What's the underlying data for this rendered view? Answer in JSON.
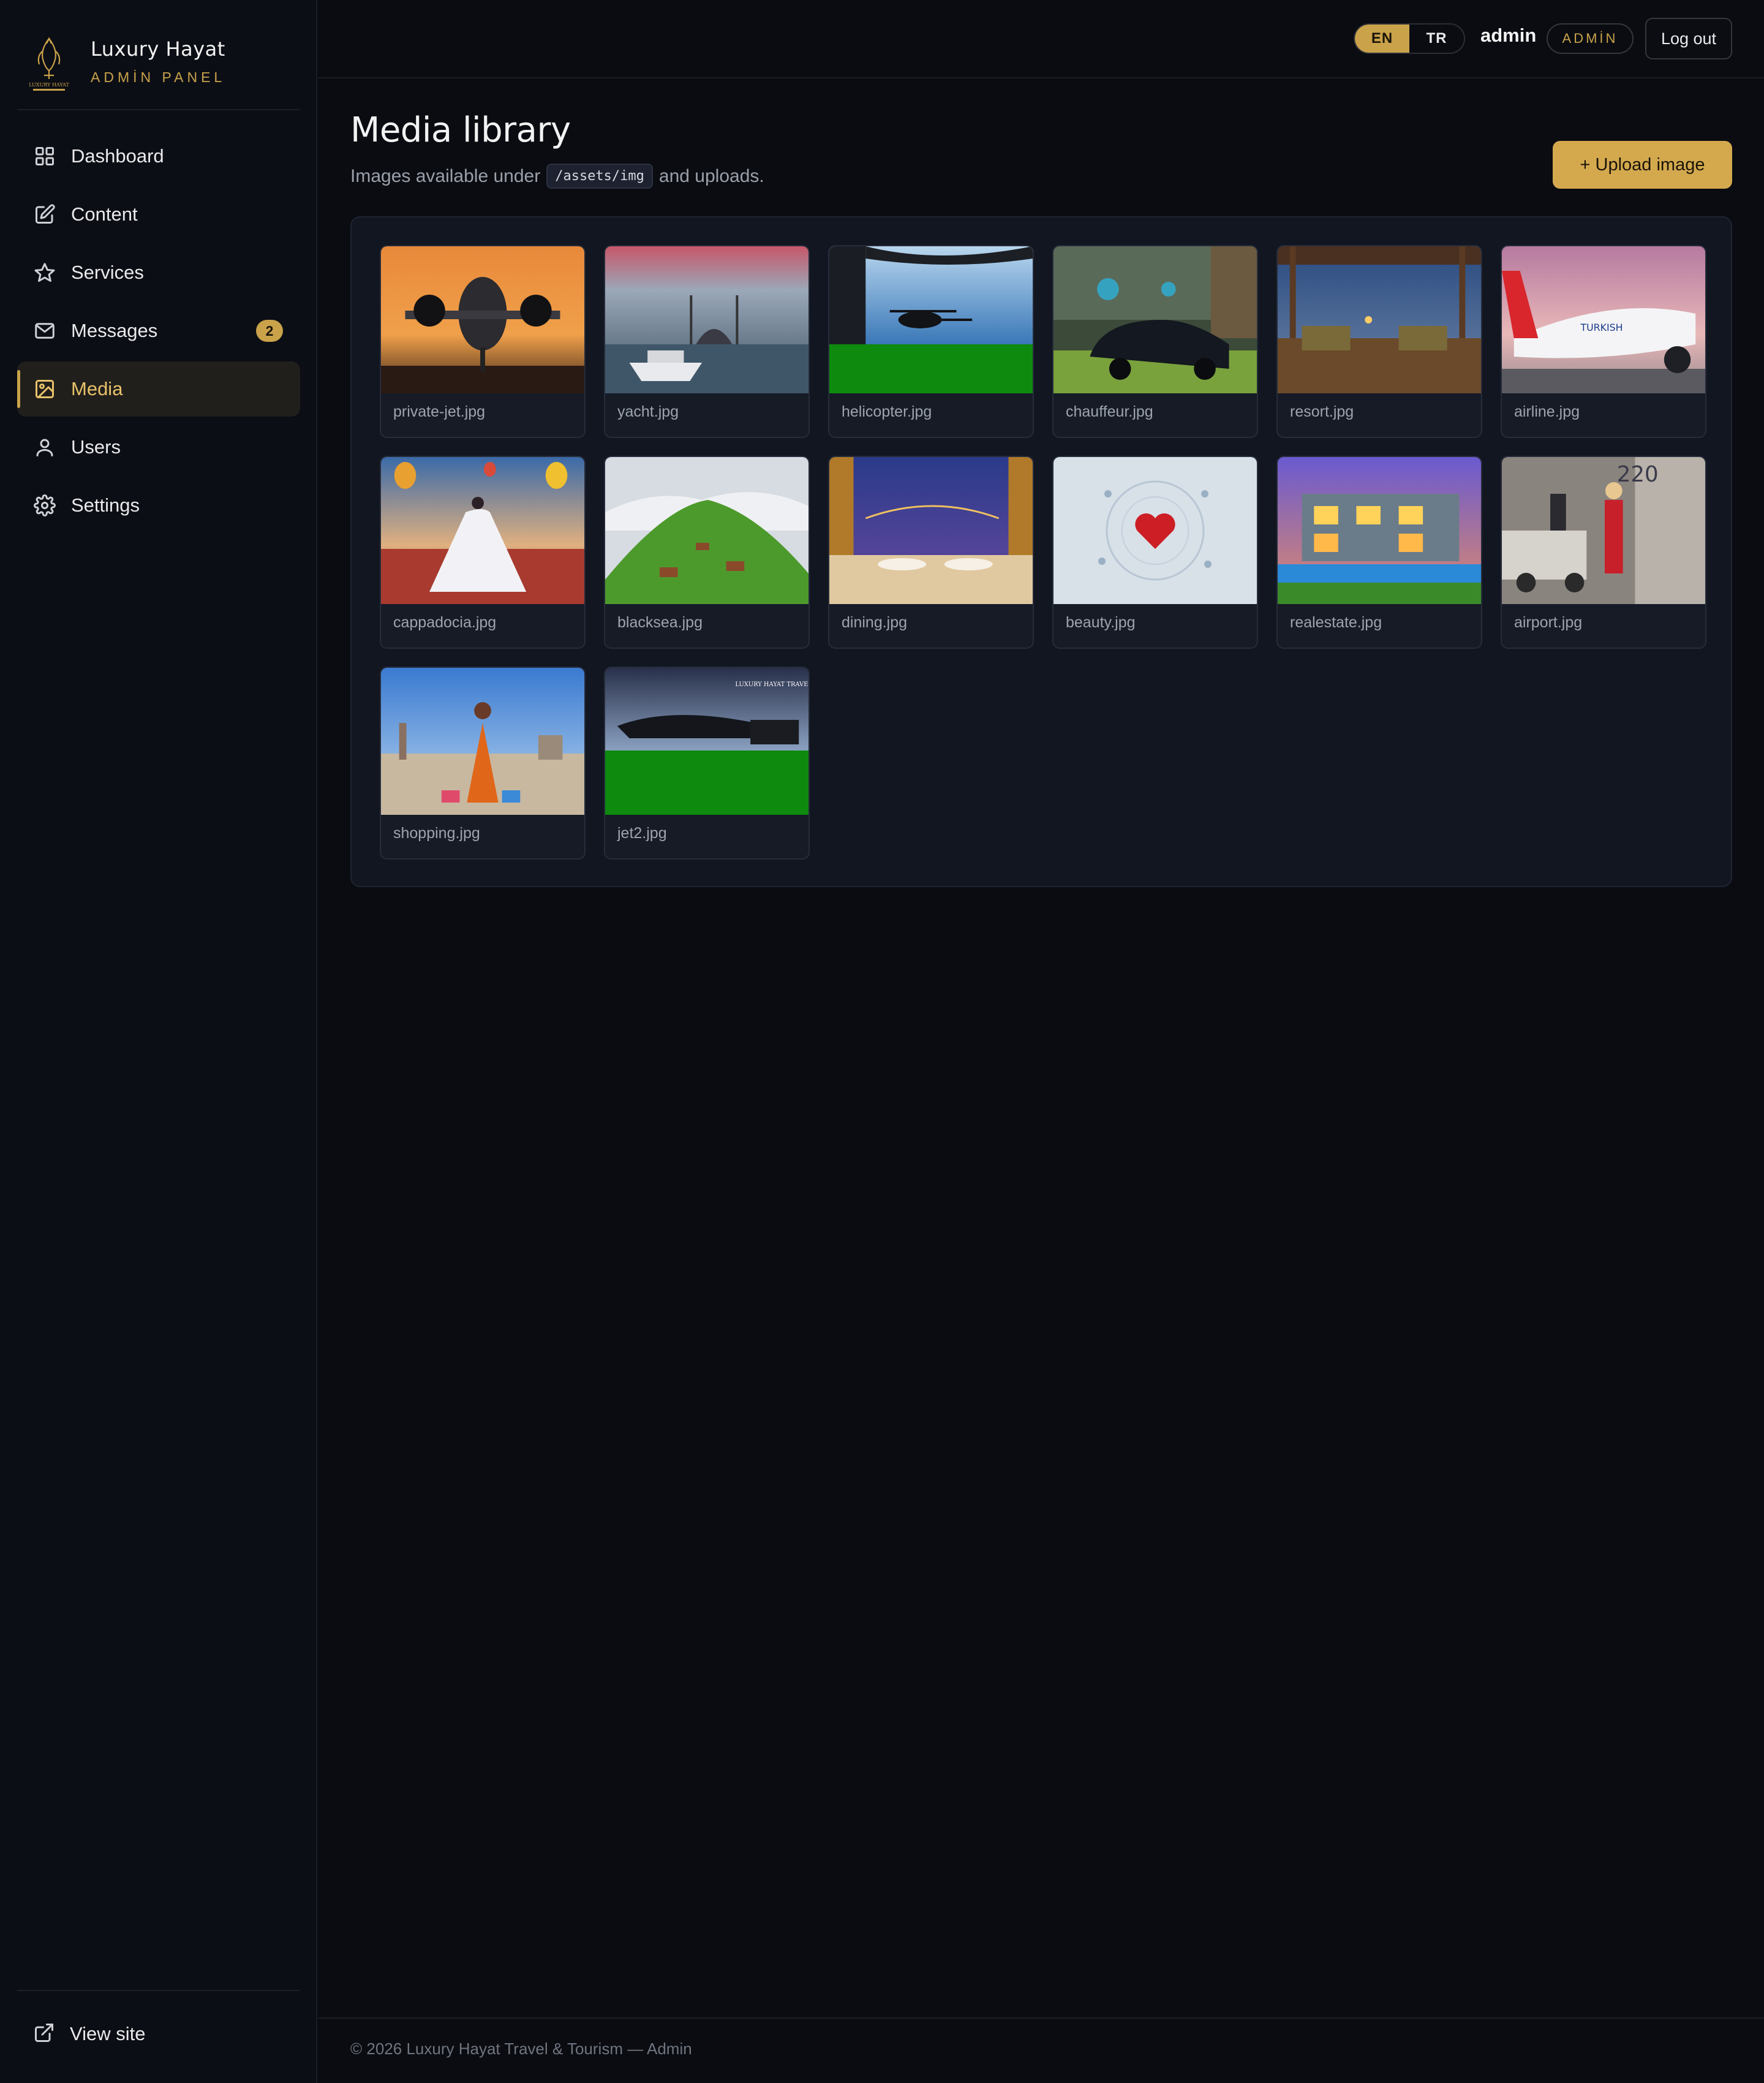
{
  "brand": {
    "title": "Luxury Hayat",
    "subtitle": "ADMİN PANEL"
  },
  "nav": [
    {
      "label": "Dashboard",
      "icon": "grid-icon"
    },
    {
      "label": "Content",
      "icon": "edit-icon"
    },
    {
      "label": "Services",
      "icon": "star-icon"
    },
    {
      "label": "Messages",
      "icon": "mail-icon",
      "badge": "2"
    },
    {
      "label": "Media",
      "icon": "image-icon",
      "active": true
    },
    {
      "label": "Users",
      "icon": "user-icon"
    },
    {
      "label": "Settings",
      "icon": "gear-icon"
    }
  ],
  "sidebar_footer": {
    "view_site": "View site"
  },
  "header": {
    "lang_en": "EN",
    "lang_tr": "TR",
    "active_lang": "EN",
    "username": "admin",
    "role": "ADMİN",
    "logout": "Log out"
  },
  "page": {
    "title": "Media library",
    "subtitle_before": "Images available under",
    "subtitle_code": "/assets/img",
    "subtitle_after": "and uploads.",
    "upload_button": "+ Upload image"
  },
  "media": [
    {
      "name": "private-jet.jpg"
    },
    {
      "name": "yacht.jpg"
    },
    {
      "name": "helicopter.jpg"
    },
    {
      "name": "chauffeur.jpg"
    },
    {
      "name": "resort.jpg"
    },
    {
      "name": "airline.jpg"
    },
    {
      "name": "cappadocia.jpg"
    },
    {
      "name": "blacksea.jpg"
    },
    {
      "name": "dining.jpg"
    },
    {
      "name": "beauty.jpg"
    },
    {
      "name": "realestate.jpg"
    },
    {
      "name": "airport.jpg"
    },
    {
      "name": "shopping.jpg"
    },
    {
      "name": "jet2.jpg"
    }
  ],
  "footer": {
    "text": "© 2026 Luxury Hayat Travel & Tourism — Admin"
  },
  "colors": {
    "accent": "#c9a24a",
    "background": "#0a0c11",
    "panel": "#121620"
  }
}
